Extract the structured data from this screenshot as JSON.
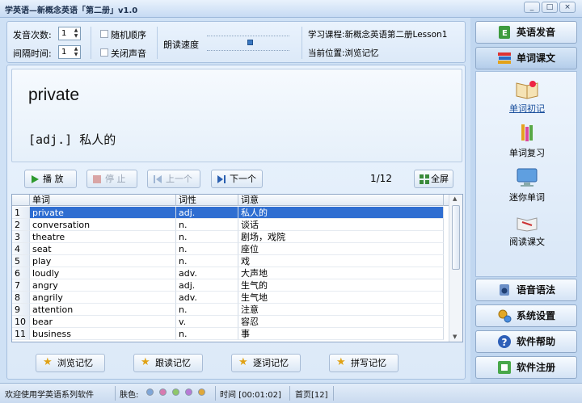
{
  "window": {
    "title": "学英语—新概念英语「第二册」v1.0",
    "controls": [
      "_",
      "□",
      "×"
    ]
  },
  "settings": {
    "repeat_label": "发音次数:",
    "repeat_value": "1",
    "interval_label": "间隔时间:",
    "interval_value": "1",
    "random_label": "随机顺序",
    "mute_label": "关闭声音",
    "speed_label": "朗读速度",
    "course_label": "学习课程:",
    "course_value": "新概念英语第二册Lesson1",
    "position_label": "当前位置:",
    "position_value": "浏览记忆"
  },
  "display": {
    "word": "private",
    "meaning": "[adj.] 私人的"
  },
  "toolbar": {
    "play": "播 放",
    "stop": "停 止",
    "prev": "上一个",
    "next": "下一个",
    "counter": "1/12",
    "fullscreen": "全屏"
  },
  "table": {
    "columns": [
      "单词",
      "词性",
      "词意"
    ],
    "rows": [
      {
        "n": "1",
        "word": "private",
        "pos": "adj.",
        "meaning": "私人的"
      },
      {
        "n": "2",
        "word": "conversation",
        "pos": "n.",
        "meaning": "谈话"
      },
      {
        "n": "3",
        "word": "theatre",
        "pos": "n.",
        "meaning": "剧场，戏院"
      },
      {
        "n": "4",
        "word": "seat",
        "pos": "n.",
        "meaning": "座位"
      },
      {
        "n": "5",
        "word": "play",
        "pos": "n.",
        "meaning": "戏"
      },
      {
        "n": "6",
        "word": "loudly",
        "pos": "adv.",
        "meaning": "大声地"
      },
      {
        "n": "7",
        "word": "angry",
        "pos": "adj.",
        "meaning": "生气的"
      },
      {
        "n": "8",
        "word": "angrily",
        "pos": "adv.",
        "meaning": "生气地"
      },
      {
        "n": "9",
        "word": "attention",
        "pos": "n.",
        "meaning": "注意"
      },
      {
        "n": "10",
        "word": "bear",
        "pos": "v.",
        "meaning": "容忍"
      },
      {
        "n": "11",
        "word": "business",
        "pos": "n.",
        "meaning": "事"
      }
    ]
  },
  "modes": [
    "浏览记忆",
    "跟读记忆",
    "逐词记忆",
    "拼写记忆"
  ],
  "sidebar": {
    "top": [
      {
        "label": "英语发音",
        "icon": "book-icon"
      },
      {
        "label": "单词课文",
        "icon": "books-stack-icon"
      }
    ],
    "sub": [
      {
        "label": "单词初记",
        "icon": "open-book-icon"
      },
      {
        "label": "单词复习",
        "icon": "crayons-icon"
      },
      {
        "label": "迷你单词",
        "icon": "monitor-icon"
      },
      {
        "label": "阅读课文",
        "icon": "reading-icon"
      }
    ],
    "bottom": [
      {
        "label": "语音语法",
        "icon": "speaker-icon"
      },
      {
        "label": "系统设置",
        "icon": "gears-icon"
      },
      {
        "label": "软件帮助",
        "icon": "help-icon"
      },
      {
        "label": "软件注册",
        "icon": "puzzle-icon"
      }
    ]
  },
  "status": {
    "welcome": "欢迎使用学英语系列软件",
    "skin_label": "肤色:",
    "skin_colors": [
      "#7fa6d8",
      "#d77ab0",
      "#8fc76a",
      "#b77ad6",
      "#e0a83a"
    ],
    "time": "时间 [00:01:02]",
    "page": "首页[12]"
  }
}
